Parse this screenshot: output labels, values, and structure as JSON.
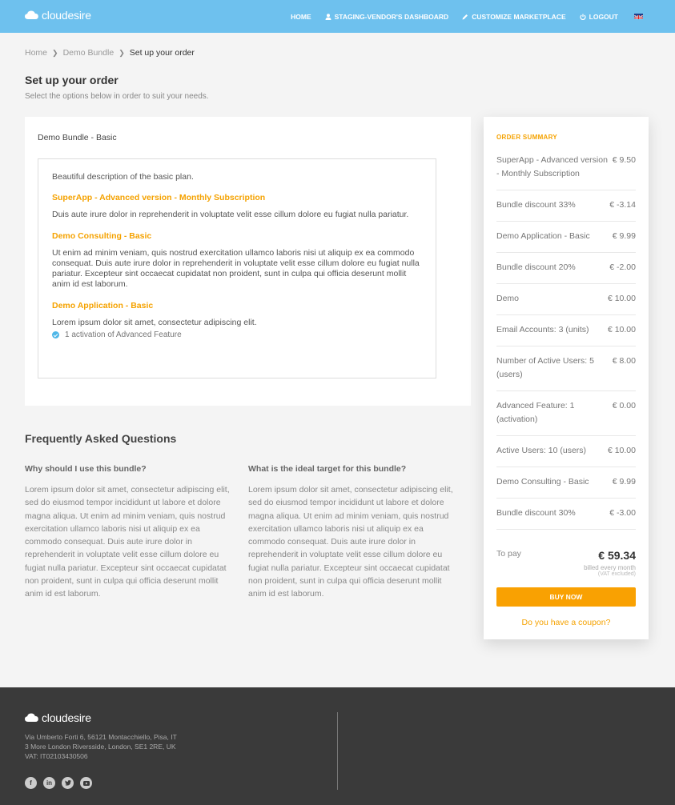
{
  "header": {
    "brand": "cloudesire",
    "nav": [
      {
        "label": "HOME",
        "icon": "none"
      },
      {
        "label": "STAGING-VENDOR'S DASHBOARD",
        "icon": "user-icon"
      },
      {
        "label": "CUSTOMIZE MARKETPLACE",
        "icon": "pencil-icon"
      },
      {
        "label": "LOGOUT",
        "icon": "power-icon"
      }
    ],
    "language_icon": "uk-flag-icon"
  },
  "breadcrumb": {
    "items": [
      "Home",
      "Demo Bundle"
    ],
    "current": "Set up your order"
  },
  "page": {
    "title": "Set up your order",
    "subtitle": "Select the options below in order to suit your needs."
  },
  "plan": {
    "name": "Demo Bundle - Basic",
    "description": "Beautiful description of the basic plan.",
    "items": [
      {
        "title": "SuperApp - Advanced version - Monthly Subscription",
        "text": "Duis aute irure dolor in reprehenderit in voluptate velit esse cillum dolore eu fugiat nulla pariatur."
      },
      {
        "title": "Demo Consulting - Basic",
        "text": "Ut enim ad minim veniam, quis nostrud exercitation ullamco laboris nisi ut aliquip ex ea commodo consequat. Duis aute irure dolor in reprehenderit in voluptate velit esse cillum dolore eu fugiat nulla pariatur. Excepteur sint occaecat cupidatat non proident, sunt in culpa qui officia deserunt mollit anim id est laborum."
      },
      {
        "title": "Demo Application - Basic",
        "text": "Lorem ipsum dolor sit amet, consectetur adipiscing elit."
      }
    ],
    "feature": "1 activation of Advanced Feature"
  },
  "faq": {
    "title": "Frequently Asked Questions",
    "questions": [
      {
        "q": "Why should I use this bundle?",
        "a": "Lorem ipsum dolor sit amet, consectetur adipiscing elit, sed do eiusmod tempor incididunt ut labore et dolore magna aliqua. Ut enim ad minim veniam, quis nostrud exercitation ullamco laboris nisi ut aliquip ex ea commodo consequat. Duis aute irure dolor in reprehenderit in voluptate velit esse cillum dolore eu fugiat nulla pariatur. Excepteur sint occaecat cupidatat non proident, sunt in culpa qui officia deserunt mollit anim id est laborum."
      },
      {
        "q": "What is the ideal target for this bundle?",
        "a": "Lorem ipsum dolor sit amet, consectetur adipiscing elit, sed do eiusmod tempor incididunt ut labore et dolore magna aliqua. Ut enim ad minim veniam, quis nostrud exercitation ullamco laboris nisi ut aliquip ex ea commodo consequat. Duis aute irure dolor in reprehenderit in voluptate velit esse cillum dolore eu fugiat nulla pariatur. Excepteur sint occaecat cupidatat non proident, sunt in culpa qui officia deserunt mollit anim id est laborum."
      }
    ]
  },
  "summary": {
    "title": "ORDER SUMMARY",
    "rows": [
      {
        "label": "SuperApp - Advanced version - Monthly Subscription",
        "value": "€ 9.50"
      },
      {
        "label": "Bundle discount 33%",
        "value": "€ -3.14"
      },
      {
        "label": "Demo Application - Basic",
        "value": "€ 9.99"
      },
      {
        "label": "Bundle discount 20%",
        "value": "€ -2.00"
      },
      {
        "label": "Demo",
        "value": "€ 10.00"
      },
      {
        "label": "Email Accounts: 3 (units)",
        "value": "€ 10.00"
      },
      {
        "label": "Number of Active Users: 5 (users)",
        "value": "€ 8.00"
      },
      {
        "label": "Advanced Feature: 1 (activation)",
        "value": "€ 0.00"
      },
      {
        "label": "Active Users: 10 (users)",
        "value": "€ 10.00"
      },
      {
        "label": "Demo Consulting - Basic",
        "value": "€ 9.99"
      },
      {
        "label": "Bundle discount 30%",
        "value": "€ -3.00"
      }
    ],
    "total_label": "To pay",
    "total": "€ 59.34",
    "billed": "billed every month",
    "vat": "(VAT excluded)",
    "buy_label": "BUY NOW",
    "coupon_label": "Do you have a coupon?"
  },
  "footer": {
    "brand": "cloudesire",
    "address": [
      "Via Umberto Forti 6, 56121 Montacchiello, Pisa, IT",
      "3 More London Riversside, London, SE1 2RE, UK",
      "VAT: IT02103430506"
    ],
    "socials": [
      "facebook-icon",
      "linkedin-icon",
      "twitter-icon",
      "youtube-icon"
    ]
  },
  "colors": {
    "header": "#6ec1ee",
    "accent": "#f9a102",
    "footer": "#3a3a3a"
  }
}
